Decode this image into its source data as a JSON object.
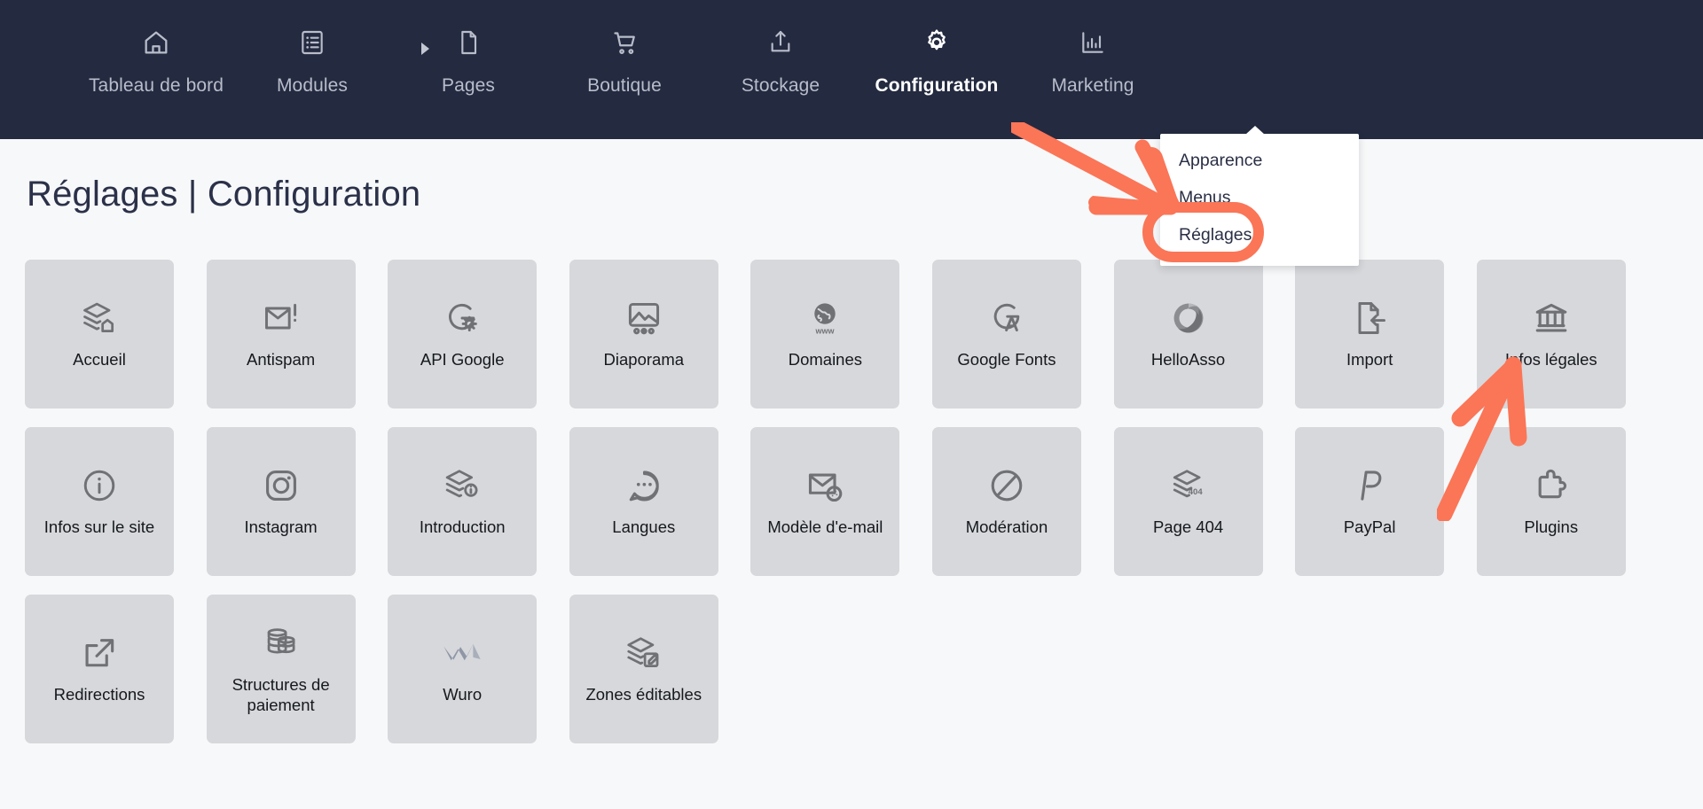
{
  "nav": {
    "items": [
      {
        "label": "Tableau de bord",
        "icon": "home-icon",
        "active": false
      },
      {
        "label": "Modules",
        "icon": "list-icon",
        "active": false
      },
      {
        "label": "Pages",
        "icon": "page-icon",
        "active": false
      },
      {
        "label": "Boutique",
        "icon": "cart-icon",
        "active": false
      },
      {
        "label": "Stockage",
        "icon": "upload-icon",
        "active": false
      },
      {
        "label": "Configuration",
        "icon": "gear-icon",
        "active": true
      },
      {
        "label": "Marketing",
        "icon": "bar-chart-icon",
        "active": false
      }
    ],
    "overflow_caret": "chevron-right-icon"
  },
  "dropdown": {
    "items": [
      {
        "label": "Apparence",
        "selected": false
      },
      {
        "label": "Menus",
        "selected": false
      },
      {
        "label": "Réglages",
        "selected": true
      }
    ]
  },
  "header": {
    "title": "Réglages | Configuration"
  },
  "colors": {
    "nav_background": "#242a40",
    "page_background": "#f7f8f9",
    "tile_background": "#d6d8db",
    "annotation": "#fb7557",
    "title_text": "#2b3149",
    "icon_gray": "#6f7174"
  },
  "annotations": [
    {
      "name": "arrow-to-reglages",
      "type": "arrow",
      "color": "#fb7557",
      "points_to": "Réglages"
    },
    {
      "name": "ring-around-reglages",
      "type": "rounded-rect-highlight",
      "color": "#fb7557",
      "points_to": "Réglages"
    },
    {
      "name": "arrow-to-infos-legales",
      "type": "arrow",
      "color": "#fb7557",
      "points_to": "Infos légales"
    }
  ],
  "tiles": [
    {
      "label": "Accueil",
      "icon": "layers-home-icon"
    },
    {
      "label": "Antispam",
      "icon": "mail-alert-icon"
    },
    {
      "label": "API Google",
      "icon": "google-gear-icon"
    },
    {
      "label": "Diaporama",
      "icon": "image-carousel-icon"
    },
    {
      "label": "Domaines",
      "icon": "globe-www-icon"
    },
    {
      "label": "Google Fonts",
      "icon": "google-fonts-icon"
    },
    {
      "label": "HelloAsso",
      "icon": "helloasso-circle-icon"
    },
    {
      "label": "Import",
      "icon": "file-import-icon"
    },
    {
      "label": "Infos légales",
      "icon": "bank-icon"
    },
    {
      "label": "Infos sur le site",
      "icon": "info-circle-icon"
    },
    {
      "label": "Instagram",
      "icon": "instagram-icon"
    },
    {
      "label": "Introduction",
      "icon": "layers-info-icon"
    },
    {
      "label": "Langues",
      "icon": "speech-bubble-icon"
    },
    {
      "label": "Modèle d'e-mail",
      "icon": "mail-palette-icon"
    },
    {
      "label": "Modération",
      "icon": "ban-icon"
    },
    {
      "label": "Page 404",
      "icon": "layers-404-icon"
    },
    {
      "label": "PayPal",
      "icon": "paypal-icon"
    },
    {
      "label": "Plugins",
      "icon": "puzzle-icon"
    },
    {
      "label": "Redirections",
      "icon": "external-link-icon"
    },
    {
      "label": "Structures de paiement",
      "icon": "coins-stack-icon"
    },
    {
      "label": "Wuro",
      "icon": "wuro-icon"
    },
    {
      "label": "Zones éditables",
      "icon": "layers-edit-icon"
    }
  ]
}
